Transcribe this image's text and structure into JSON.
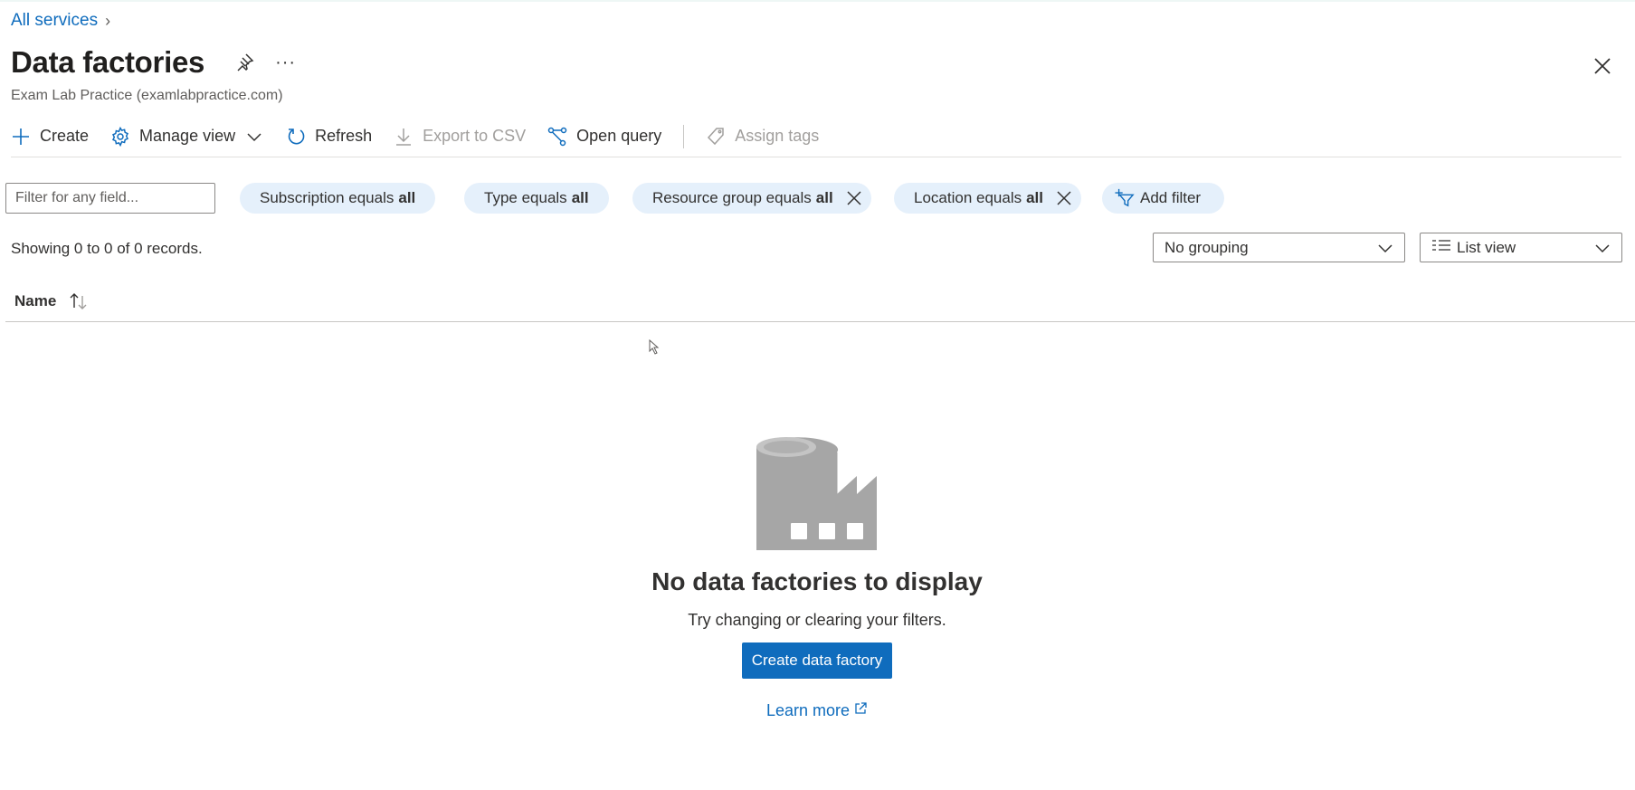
{
  "breadcrumb": {
    "link": "All services"
  },
  "header": {
    "title": "Data factories",
    "subtitle": "Exam Lab Practice (examlabpractice.com)",
    "more": "···"
  },
  "toolbar": {
    "create": "Create",
    "manage_view": "Manage view",
    "refresh": "Refresh",
    "export_csv": "Export to CSV",
    "open_query": "Open query",
    "assign_tags": "Assign tags"
  },
  "filters": {
    "placeholder": "Filter for any field...",
    "pills": [
      {
        "label": "Subscription equals",
        "value": "all"
      },
      {
        "label": "Type equals",
        "value": "all"
      },
      {
        "label": "Resource group equals",
        "value": "all"
      },
      {
        "label": "Location equals",
        "value": "all"
      }
    ],
    "add_filter": "Add filter"
  },
  "records": {
    "summary": "Showing 0 to 0 of 0 records."
  },
  "grouping": {
    "selected": "No grouping"
  },
  "view": {
    "selected": "List view"
  },
  "table": {
    "columns": [
      "Name"
    ]
  },
  "empty_state": {
    "title": "No data factories to display",
    "message": "Try changing or clearing your filters.",
    "button": "Create data factory",
    "link": "Learn more"
  },
  "colors": {
    "accent": "#0f6cbd",
    "pill_bg": "#e5f0fb",
    "icon_gray": "#a6a6a6"
  }
}
